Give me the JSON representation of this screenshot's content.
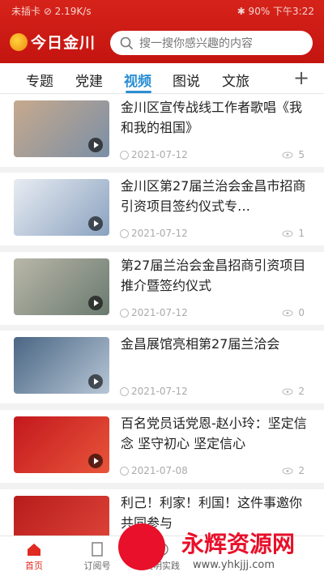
{
  "status_bar": {
    "left": "未插卡 ⊘ 2.19K/s",
    "right": "✱ 90% 下午3:22"
  },
  "header": {
    "app_name": "今日金川",
    "search_placeholder": "搜一搜你感兴趣的内容"
  },
  "tabs": {
    "items": [
      "专题",
      "党建",
      "视频",
      "图说",
      "文旅"
    ],
    "active": "视频"
  },
  "articles": [
    {
      "title": "金川区宣传战线工作者歌唱《我和我的祖国》",
      "date": "2021-07-12",
      "views": "5"
    },
    {
      "title": "金川区第27届兰治会金昌市招商引资项目签约仪式专…",
      "date": "2021-07-12",
      "views": "1"
    },
    {
      "title": "第27届兰治会金昌招商引资项目推介暨签约仪式",
      "date": "2021-07-12",
      "views": "0"
    },
    {
      "title": "金昌展馆亮相第27届兰洽会",
      "date": "2021-07-12",
      "views": "2"
    },
    {
      "title": "百名党员话党恩-赵小玲：坚定信念 坚守初心 坚定信心",
      "date": "2021-07-08",
      "views": "2"
    },
    {
      "title": "利己！利家！利国！这件事邀你共同参与",
      "date": "",
      "views": ""
    }
  ],
  "bottom_nav": {
    "items": [
      "首页",
      "订阅号",
      "文明实践",
      "",
      ""
    ],
    "active": "首页"
  },
  "watermark": {
    "text": "永辉资源网",
    "url": "www.yhkjjj.com"
  },
  "colors": {
    "header_red": "#d6231a",
    "active_blue": "#2a8fd4",
    "nav_active_red": "#e02a22"
  }
}
